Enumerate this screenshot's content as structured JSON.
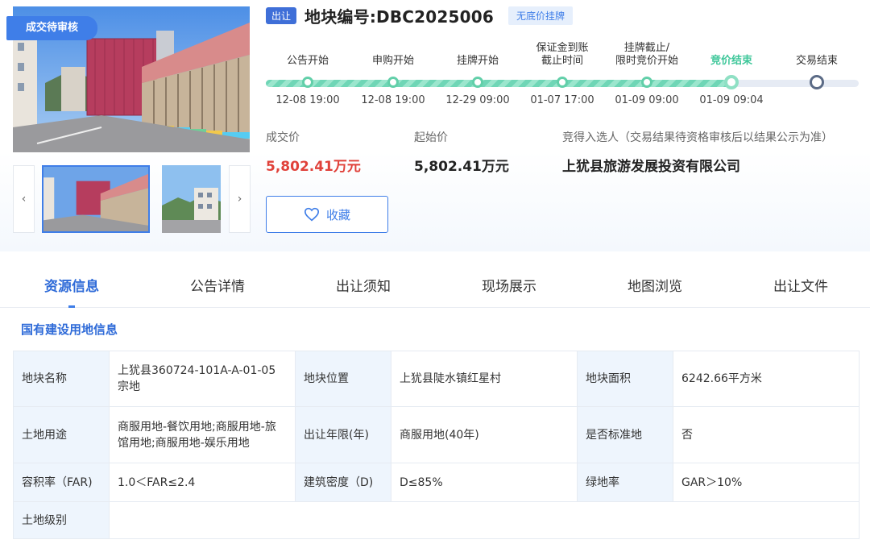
{
  "status_badge": "成交待审核",
  "listing": {
    "type_tag": "出让",
    "title": "地块编号:DBC2025006",
    "no_floor_tag": "无底价挂牌"
  },
  "timeline": {
    "progress_fraction": 0.786,
    "steps": [
      {
        "label": "公告开始",
        "time": "12-08 19:00"
      },
      {
        "label": "申购开始",
        "time": "12-08 19:00"
      },
      {
        "label": "挂牌开始",
        "time": "12-29 09:00"
      },
      {
        "label": "保证金到账截止时间",
        "label_line1": "保证金到账",
        "label_line2": "截止时间",
        "time": "01-07 17:00"
      },
      {
        "label": "挂牌截止/限时竞价开始",
        "label_line1": "挂牌截止/",
        "label_line2": "限时竞价开始",
        "time": "01-09 09:00"
      },
      {
        "label": "竞价结束",
        "time": "01-09 09:04",
        "active": true
      },
      {
        "label": "交易结束",
        "time": ""
      }
    ]
  },
  "price": {
    "deal_label": "成交价",
    "deal_value": "5,802.41万元",
    "start_label": "起始价",
    "start_value": "5,802.41万元",
    "winner_label": "竞得入选人（交易结果待资格审核后以结果公示为准）",
    "winner_value": "上犹县旅游发展投资有限公司"
  },
  "favorite_label": "收藏",
  "tabs": [
    "资源信息",
    "公告详情",
    "出让须知",
    "现场展示",
    "地图浏览",
    "出让文件"
  ],
  "section_title": "国有建设用地信息",
  "info": {
    "r1": [
      {
        "k": "地块名称",
        "v": "上犹县360724-101A-A-01-05宗地"
      },
      {
        "k": "地块位置",
        "v": "上犹县陡水镇红星村"
      },
      {
        "k": "地块面积",
        "v": "6242.66平方米"
      }
    ],
    "r2": [
      {
        "k": "土地用途",
        "v": "商服用地-餐饮用地;商服用地-旅馆用地;商服用地-娱乐用地"
      },
      {
        "k": "出让年限(年)",
        "v": "商服用地(40年)"
      },
      {
        "k": "是否标准地",
        "v": "否"
      }
    ],
    "r3": [
      {
        "k": "容积率（FAR)",
        "v": "1.0＜FAR≤2.4"
      },
      {
        "k": "建筑密度（D)",
        "v": "D≤85%"
      },
      {
        "k": "绿地率",
        "v": "GAR＞10%"
      }
    ],
    "r4": [
      {
        "k": "土地级别",
        "v": ""
      }
    ]
  },
  "colors": {
    "accent": "#3f7ee8",
    "deal_price": "#e0413a",
    "timeline_done": "#62cfa9",
    "key_cell_bg": "#eef5fd"
  }
}
